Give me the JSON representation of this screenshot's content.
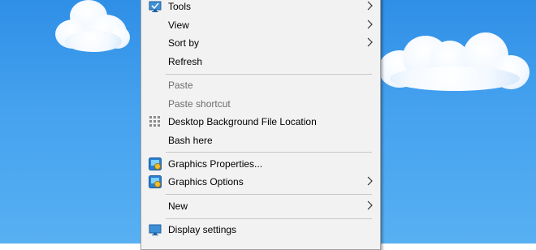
{
  "desktop": {
    "background_colors": [
      "#2f8fe6",
      "#58b0f2"
    ]
  },
  "context_menu": {
    "items": [
      {
        "label": "Tools",
        "icon": "monitor-check-icon",
        "submenu": true,
        "enabled": true
      },
      {
        "label": "View",
        "submenu": true,
        "enabled": true
      },
      {
        "label": "Sort by",
        "submenu": true,
        "enabled": true
      },
      {
        "label": "Refresh",
        "enabled": true
      },
      {
        "label": "Paste",
        "enabled": false
      },
      {
        "label": "Paste shortcut",
        "enabled": false
      },
      {
        "label": "Desktop Background File Location",
        "icon": "grid-dots-icon",
        "enabled": true
      },
      {
        "label": "Bash here",
        "enabled": true
      },
      {
        "label": "Graphics Properties...",
        "icon": "intel-graphics-icon",
        "enabled": true
      },
      {
        "label": "Graphics Options",
        "icon": "intel-graphics-icon",
        "submenu": true,
        "enabled": true
      },
      {
        "label": "New",
        "submenu": true,
        "enabled": true
      },
      {
        "label": "Display settings",
        "icon": "display-icon",
        "enabled": true
      }
    ]
  }
}
